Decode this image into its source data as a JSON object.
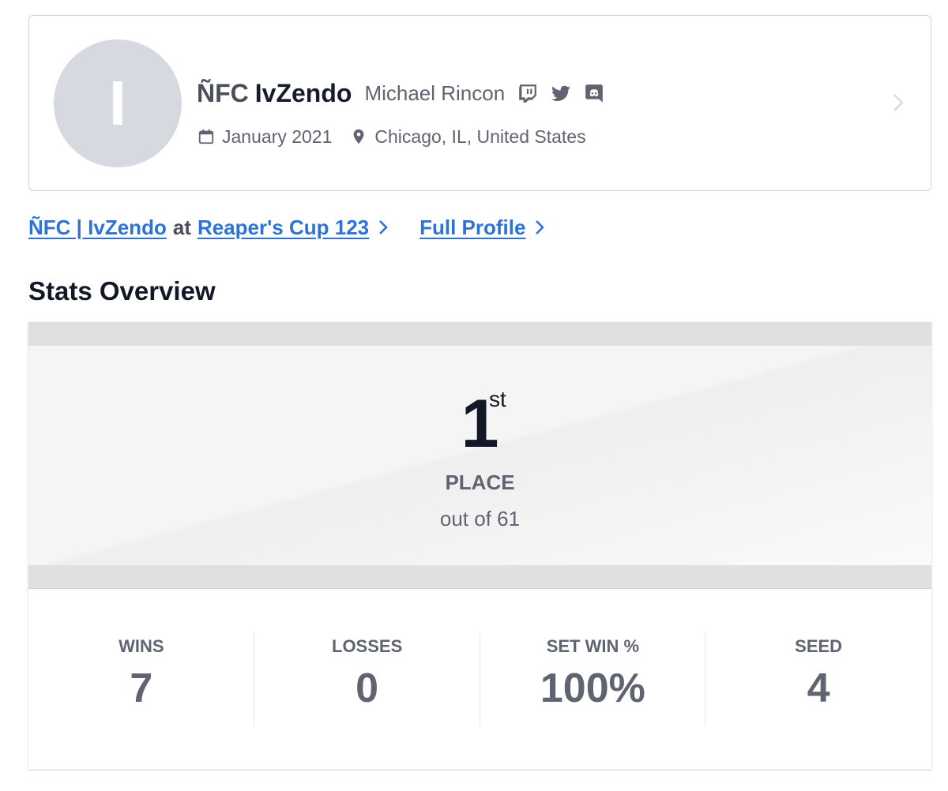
{
  "profile": {
    "avatar_initial": "I",
    "prefix": "ÑFC",
    "gamertag": "IvZendo",
    "real_name": "Michael Rincon",
    "social_icons": [
      "twitch-icon",
      "twitter-icon",
      "discord-icon"
    ],
    "joined": "January 2021",
    "location": "Chicago, IL, United States"
  },
  "links": {
    "player_link": "ÑFC | IvZendo",
    "joiner": "at",
    "tournament_link": "Reaper's Cup 123",
    "full_profile": "Full Profile"
  },
  "stats": {
    "title": "Stats Overview",
    "place": {
      "number": "1",
      "suffix": "st",
      "label": "PLACE",
      "out_of": "out of 61"
    },
    "items": [
      {
        "label": "WINS",
        "value": "7"
      },
      {
        "label": "LOSSES",
        "value": "0"
      },
      {
        "label": "SET WIN %",
        "value": "100%"
      },
      {
        "label": "SEED",
        "value": "4"
      }
    ]
  },
  "colors": {
    "link": "#2f72d6",
    "muted": "#5f6470",
    "dark": "#121826",
    "avatar_bg": "#d6d9df",
    "band": "#e0e0e0"
  }
}
